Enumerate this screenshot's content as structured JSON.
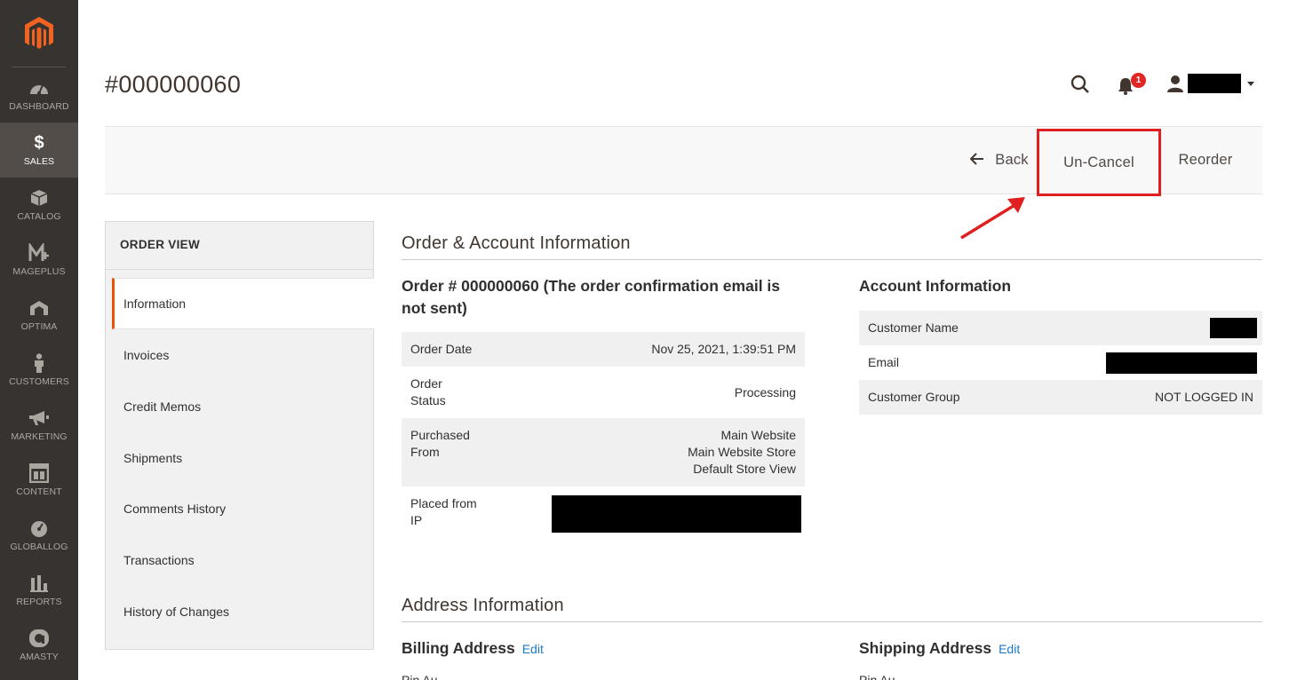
{
  "sidebar": {
    "items": [
      {
        "label": "DASHBOARD",
        "icon": "dashboard-icon"
      },
      {
        "label": "SALES",
        "icon": "dollar-icon",
        "active": true
      },
      {
        "label": "CATALOG",
        "icon": "box-icon"
      },
      {
        "label": "MAGEPLUS",
        "icon": "mageplus-icon"
      },
      {
        "label": "OPTIMA",
        "icon": "optima-icon"
      },
      {
        "label": "CUSTOMERS",
        "icon": "person-icon"
      },
      {
        "label": "MARKETING",
        "icon": "megaphone-icon"
      },
      {
        "label": "CONTENT",
        "icon": "layout-icon"
      },
      {
        "label": "GLOBALLOG",
        "icon": "gauge-icon"
      },
      {
        "label": "REPORTS",
        "icon": "bar-chart-icon"
      },
      {
        "label": "AMASTY",
        "icon": "amasty-icon"
      }
    ]
  },
  "header": {
    "title": "#000000060",
    "notification_count": "1"
  },
  "actions": {
    "back_label": "Back",
    "uncancel_label": "Un-Cancel",
    "reorder_label": "Reorder"
  },
  "tabs": {
    "title": "ORDER VIEW",
    "items": [
      "Information",
      "Invoices",
      "Credit Memos",
      "Shipments",
      "Comments History",
      "Transactions",
      "History of Changes"
    ]
  },
  "order_account": {
    "section_title": "Order & Account Information",
    "order_heading_line1": "Order # 000000060 (The order confirmation email is",
    "order_heading_line2": "not sent)",
    "order_date_label": "Order Date",
    "order_date_value": "Nov 25, 2021, 1:39:51 PM",
    "order_status_label_1": "Order",
    "order_status_label_2": "Status",
    "order_status_value": "Processing",
    "purchased_from_label_1": "Purchased",
    "purchased_from_label_2": "From",
    "purchased_from_value_1": "Main Website",
    "purchased_from_value_2": "Main Website Store",
    "purchased_from_value_3": "Default Store View",
    "placed_ip_label_1": "Placed from",
    "placed_ip_label_2": "IP",
    "account_heading": "Account Information",
    "customer_name_label": "Customer Name",
    "email_label": "Email",
    "customer_group_label": "Customer Group",
    "customer_group_value": "NOT LOGGED IN"
  },
  "address": {
    "section_title": "Address Information",
    "billing_heading": "Billing Address",
    "shipping_heading": "Shipping Address",
    "edit_label": "Edit",
    "billing_cut": "Pin Au",
    "shipping_cut": "Pin Au"
  },
  "colors": {
    "sidebar_bg": "#373330",
    "sidebar_active": "#524d49",
    "accent": "#eb5202",
    "highlight": "#e02020",
    "link": "#1979c3"
  }
}
